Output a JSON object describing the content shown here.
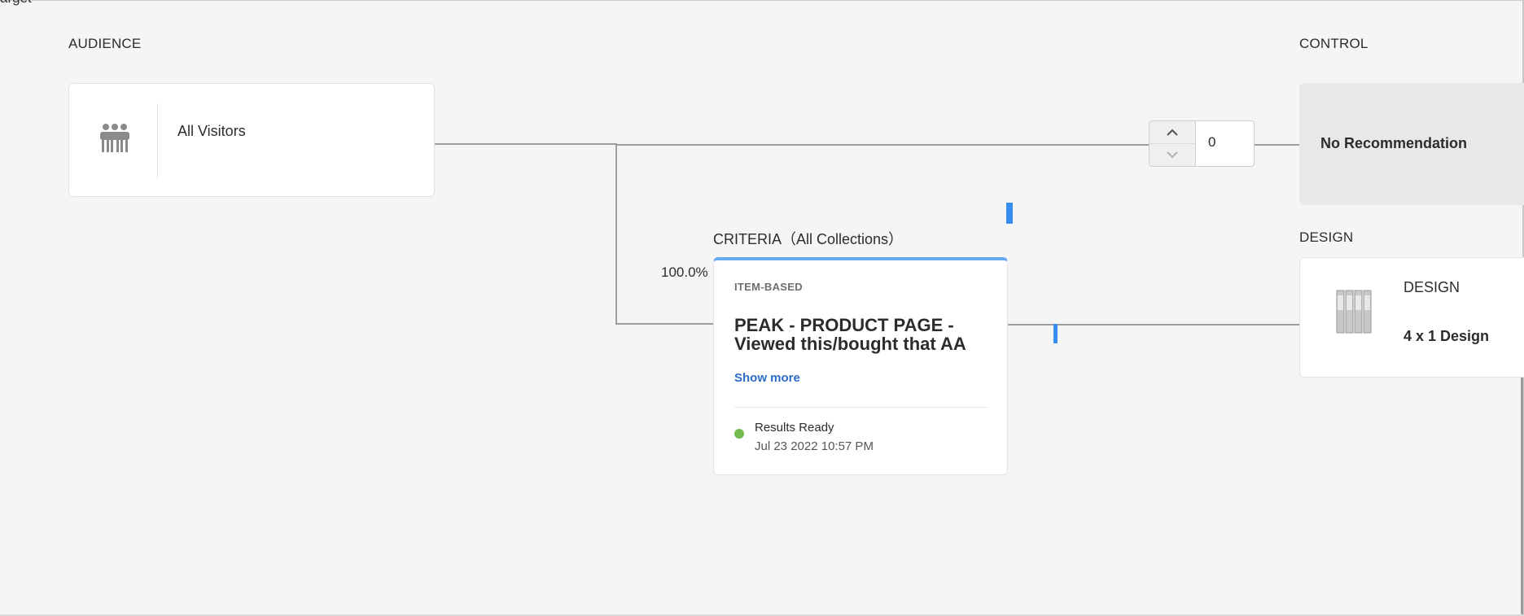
{
  "app": {
    "title_fragment": "arget"
  },
  "audience": {
    "label": "AUDIENCE",
    "name": "All Visitors"
  },
  "control": {
    "label": "CONTROL",
    "stepper_value": "0",
    "name": "No Recommendation"
  },
  "criteria": {
    "label": "CRITERIA（All Collections）",
    "percentage": "100.0%",
    "type": "ITEM-BASED",
    "name": "PEAK - PRODUCT PAGE - Viewed this/bought that AA",
    "show_more": "Show more",
    "status": "Results Ready",
    "status_time": "Jul 23 2022 10:57 PM"
  },
  "design": {
    "label": "DESIGN",
    "title": "DESIGN",
    "name": "4 x 1 Design"
  },
  "icons": {
    "audience": "people-group-icon",
    "stepper_up": "chevron-up-icon",
    "stepper_down": "chevron-down-icon",
    "status": "status-dot-icon",
    "design": "design-thumbnail-icon"
  },
  "colors": {
    "accent": "#378ef0",
    "link": "#2d6dc9",
    "status_ready": "#72bc4f",
    "card_top_border": "#69a9f0"
  }
}
